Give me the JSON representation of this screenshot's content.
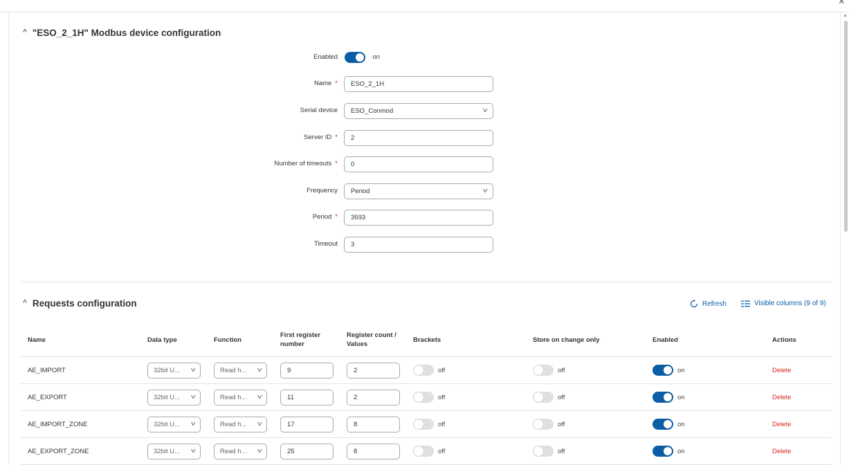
{
  "window": {
    "close_glyph": "×"
  },
  "device": {
    "title": "\"ESO_2_1H\" Modbus device configuration",
    "fields": {
      "enabled": {
        "label": "Enabled",
        "state": "on"
      },
      "name": {
        "label": "Name",
        "value": "ESO_2_1H",
        "required": "*"
      },
      "serial_device": {
        "label": "Serial device",
        "value": "ESO_Conmod"
      },
      "server_id": {
        "label": "Server ID",
        "value": "2",
        "required": "*"
      },
      "timeouts": {
        "label": "Number of timeouts",
        "value": "0",
        "required": "*"
      },
      "frequency": {
        "label": "Frequency",
        "value": "Period"
      },
      "period": {
        "label": "Period",
        "value": "3593",
        "required": "*"
      },
      "timeout": {
        "label": "Timeout",
        "value": "3"
      }
    }
  },
  "requests": {
    "title": "Requests configuration",
    "refresh_label": "Refresh",
    "visible_columns_label": "Visible columns (9 of 9)",
    "columns": {
      "name": "Name",
      "data_type": "Data type",
      "function": "Function",
      "first_register_1": "First register",
      "first_register_2": "number",
      "register_count_1": "Register count /",
      "register_count_2": "Values",
      "brackets": "Brackets",
      "store_on_change": "Store on change only",
      "enabled": "Enabled",
      "actions": "Actions"
    },
    "rows": [
      {
        "name": "AE_IMPORT",
        "data_type": "32bit U...",
        "function": "Read h...",
        "first_register": "9",
        "register_count": "2",
        "brackets": "off",
        "store_on_change": "off",
        "enabled": "on",
        "action": "Delete"
      },
      {
        "name": "AE_EXPORT",
        "data_type": "32bit U...",
        "function": "Read h...",
        "first_register": "11",
        "register_count": "2",
        "brackets": "off",
        "store_on_change": "off",
        "enabled": "on",
        "action": "Delete"
      },
      {
        "name": "AE_IMPORT_ZONE",
        "data_type": "32bit U...",
        "function": "Read h...",
        "first_register": "17",
        "register_count": "8",
        "brackets": "off",
        "store_on_change": "off",
        "enabled": "on",
        "action": "Delete"
      },
      {
        "name": "AE_EXPORT_ZONE",
        "data_type": "32bit U...",
        "function": "Read h...",
        "first_register": "25",
        "register_count": "8",
        "brackets": "off",
        "store_on_change": "off",
        "enabled": "on",
        "action": "Delete"
      }
    ]
  },
  "colors": {
    "accent": "#0b5ea6",
    "danger": "#d9251d",
    "border": "#a9a9a9"
  },
  "icons": {
    "collapse": "chevron-up-icon",
    "dropdown": "chevron-down-icon",
    "refresh": "refresh-icon",
    "columns": "columns-icon",
    "close": "close-icon"
  }
}
